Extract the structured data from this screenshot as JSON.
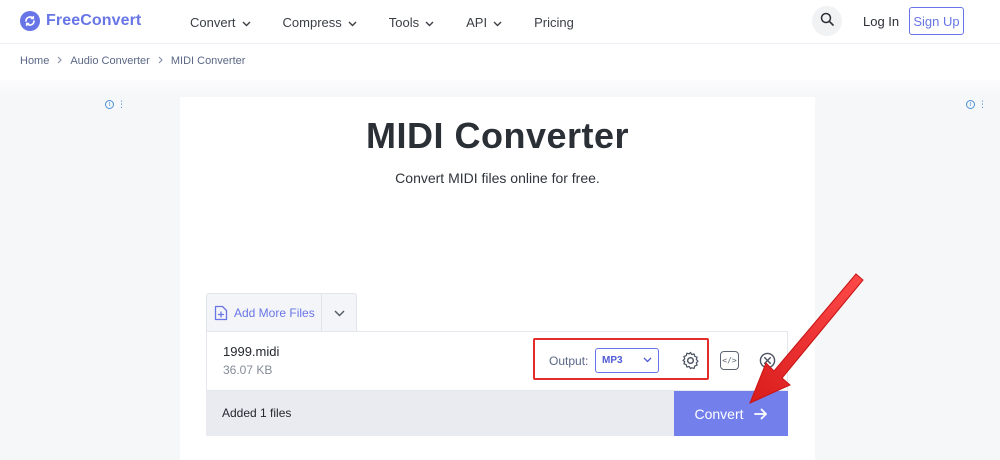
{
  "header": {
    "brand": "FreeConvert",
    "nav": [
      {
        "label": "Convert",
        "has_dropdown": true
      },
      {
        "label": "Compress",
        "has_dropdown": true
      },
      {
        "label": "Tools",
        "has_dropdown": true
      },
      {
        "label": "API",
        "has_dropdown": true
      },
      {
        "label": "Pricing",
        "has_dropdown": false
      }
    ],
    "search_icon": "search-icon",
    "login_label": "Log In",
    "signup_label": "Sign Up"
  },
  "breadcrumb": [
    "Home",
    "Audio Converter",
    "MIDI Converter"
  ],
  "main": {
    "title": "MIDI Converter",
    "subtitle": "Convert MIDI files online for free."
  },
  "uploader": {
    "add_more_label": "Add More Files",
    "file": {
      "name": "1999.midi",
      "size": "36.07 KB"
    },
    "output_label": "Output:",
    "output_format": "MP3",
    "added_status": "Added 1 files",
    "convert_label": "Convert"
  },
  "colors": {
    "brand": "#6875e6",
    "convert_button": "#7380eb",
    "annotation": "#e32c2c"
  }
}
